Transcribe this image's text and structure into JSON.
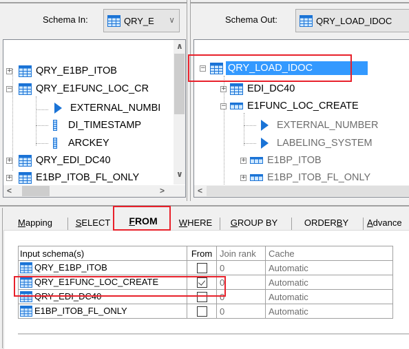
{
  "schema_in": {
    "label": "Schema In:",
    "value": "QRY_E",
    "icon": "table-icon"
  },
  "schema_out": {
    "label": "Schema Out:",
    "value": "QRY_LOAD_IDOC",
    "icon": "table-icon"
  },
  "left_tree": {
    "items": [
      {
        "label": "QRY_E1BP_ITOB",
        "type": "table",
        "expander": "+"
      },
      {
        "label": "QRY_E1FUNC_LOC_CR",
        "type": "table",
        "expander": "-"
      },
      {
        "label": "EXTERNAL_NUMBI",
        "type": "field-arrow"
      },
      {
        "label": "DI_TIMESTAMP",
        "type": "column"
      },
      {
        "label": "ARCKEY",
        "type": "column"
      },
      {
        "label": "QRY_EDI_DC40",
        "type": "table",
        "expander": "+"
      },
      {
        "label": "E1BP_ITOB_FL_ONLY",
        "type": "table",
        "expander": "+"
      }
    ]
  },
  "right_tree": {
    "items": [
      {
        "label": "QRY_LOAD_IDOC",
        "type": "table",
        "expander": "-",
        "selected": true
      },
      {
        "label": "EDI_DC40",
        "type": "table",
        "expander": "+"
      },
      {
        "label": "E1FUNC_LOC_CREATE",
        "type": "subtable",
        "expander": "-"
      },
      {
        "label": "EXTERNAL_NUMBER",
        "type": "field-arrow"
      },
      {
        "label": "LABELING_SYSTEM",
        "type": "field-arrow"
      },
      {
        "label": "E1BP_ITOB",
        "type": "subtable",
        "expander": "+"
      },
      {
        "label": "E1BP_ITOB_FL_ONLY",
        "type": "subtable",
        "expander": "+"
      }
    ]
  },
  "tabs": [
    {
      "label": "Mapping",
      "mnemonic": "M",
      "rest": "apping"
    },
    {
      "label": "SELECT",
      "mnemonic": "S",
      "rest": "ELECT"
    },
    {
      "label": "FROM",
      "mnemonic": "F",
      "rest": "ROM",
      "active": true
    },
    {
      "label": "WHERE",
      "mnemonic": "W",
      "rest": "HERE"
    },
    {
      "label": "GROUP BY",
      "mnemonic": "G",
      "rest": "ROUP BY"
    },
    {
      "label": "ORDER BY",
      "pre": "ORDER ",
      "mnemonic": "B",
      "rest": "Y"
    },
    {
      "label": "Advanced",
      "mnemonic": "A",
      "rest": "dvance"
    }
  ],
  "from_table": {
    "headers": [
      "Input schema(s)",
      "From",
      "Join rank",
      "Cache"
    ],
    "rows": [
      {
        "schema": "QRY_E1BP_ITOB",
        "from": false,
        "join_rank": "0",
        "cache": "Automatic"
      },
      {
        "schema": "QRY_E1FUNC_LOC_CREATE",
        "from": true,
        "join_rank": "0",
        "cache": "Automatic"
      },
      {
        "schema": "QRY_EDI_DC40",
        "from": false,
        "join_rank": "0",
        "cache": "Automatic"
      },
      {
        "schema": "E1BP_ITOB_FL_ONLY",
        "from": false,
        "join_rank": "0",
        "cache": "Automatic"
      }
    ]
  },
  "colors": {
    "highlight": "#e8202a",
    "selection": "#3399ff",
    "icon_blue": "#1a73d6"
  }
}
